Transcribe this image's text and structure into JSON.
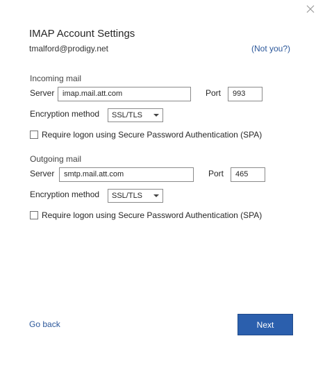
{
  "dialog": {
    "title": "IMAP Account Settings",
    "email": "tmalford@prodigy.net",
    "not_you": "(Not you?)",
    "close_icon": "close-icon"
  },
  "incoming": {
    "heading": "Incoming mail",
    "server_label": "Server",
    "server_value": "imap.mail.att.com",
    "port_label": "Port",
    "port_value": "993",
    "encryption_label": "Encryption method",
    "encryption_value": "SSL/TLS",
    "spa_label": "Require logon using Secure Password Authentication (SPA)",
    "spa_checked": false
  },
  "outgoing": {
    "heading": "Outgoing mail",
    "server_label": "Server",
    "server_value": "smtp.mail.att.com",
    "port_label": "Port",
    "port_value": "465",
    "encryption_label": "Encryption method",
    "encryption_value": "SSL/TLS",
    "spa_label": "Require logon using Secure Password Authentication (SPA)",
    "spa_checked": false
  },
  "footer": {
    "go_back": "Go back",
    "next": "Next"
  },
  "colors": {
    "accent": "#2b5fad",
    "link": "#2b579a"
  }
}
